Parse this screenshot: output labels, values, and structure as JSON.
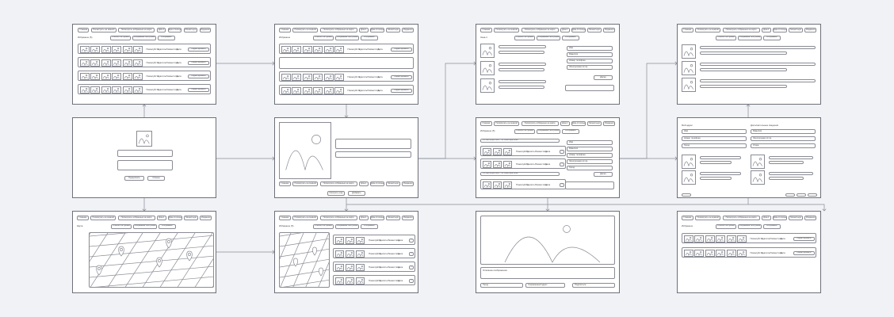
{
  "nav": [
    "Главная",
    "Посмотреть на земной",
    "Посмотреть избранные на карте",
    "Дом-1",
    "Дом-столицы",
    "Монастыри",
    "Изданное"
  ],
  "views": [
    "Список постройки",
    "Избранные постройки",
    "Избранное"
  ],
  "labels": {
    "favorites_count": "Избранное (5)",
    "favorites": "Избранное",
    "map": "Карта",
    "zone": "Зона-1",
    "my_data": "Мой адрес",
    "additional": "Дополнительные сведения",
    "description": "Описание изображения"
  },
  "actions": [
    "Пожалуйста",
    "Удалить",
    "Разместить",
    "Дата",
    "Редактировать"
  ],
  "buttons": {
    "submit": "Продолжить",
    "cancel": "Отмена",
    "share": "Поделиться",
    "more": "Смотреть еще",
    "add": "Добавить",
    "next": "Далее"
  },
  "fields": [
    "Имя",
    "Фамилия",
    "Номер телефона",
    "Электронная почта",
    "Город",
    "Улица",
    "Сохраненный адрес"
  ],
  "dates": [
    "21 сентября 2021 - 21 сентября 2022",
    "21 сентября 2021 - 21 сентября 2022"
  ],
  "colors": {
    "background": "#f1f2f6",
    "frame_border": "#6e7079",
    "element_border": "#8a8c94",
    "connector": "#8a8c94"
  }
}
